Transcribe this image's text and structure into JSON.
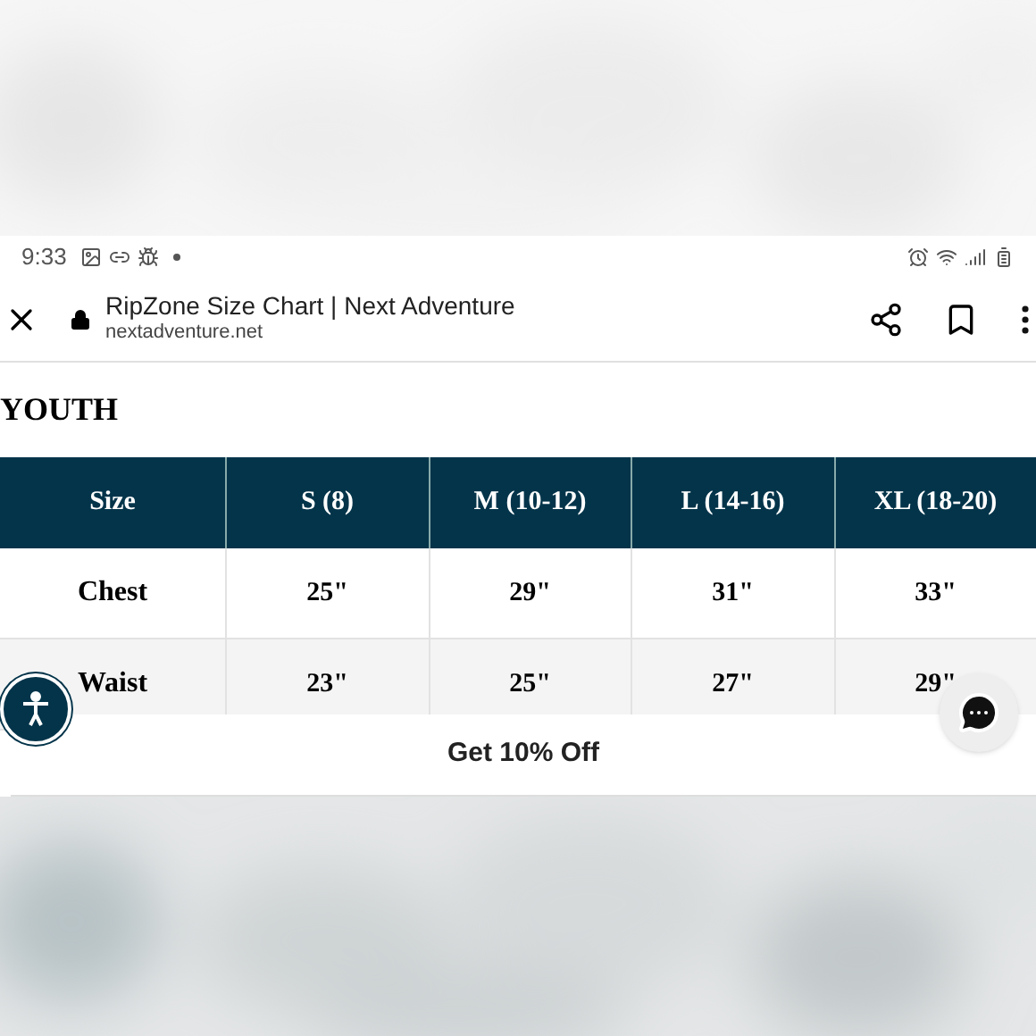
{
  "status_bar": {
    "time": "9:33"
  },
  "browser": {
    "title": "RipZone Size Chart | Next Adventure",
    "url": "nextadventure.net"
  },
  "heading": "YOUTH",
  "table": {
    "columns": [
      "Size",
      "S (8)",
      "M (10-12)",
      "L (14-16)",
      "XL (18-20)"
    ],
    "rows": [
      [
        "Chest",
        "25\"",
        "29\"",
        "31\"",
        "33\""
      ],
      [
        "Waist",
        "23\"",
        "25\"",
        "27\"",
        "29\""
      ]
    ]
  },
  "banner": {
    "label": "Get 10% Off"
  }
}
